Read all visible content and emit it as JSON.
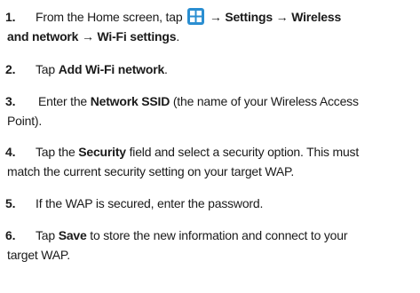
{
  "steps": [
    {
      "number": "1.",
      "pre": "From the Home screen, tap",
      "icon": "apps-grid-icon",
      "arrow1": "→",
      "settings": "Settings",
      "arrow2": "→",
      "wireless_line1": "Wireless",
      "wireless_line2": "and network",
      "arrow3": "→",
      "wifi_settings": "Wi-Fi settings",
      "end": "."
    },
    {
      "number": "2.",
      "pre": "Tap",
      "bold": "Add Wi-Fi network",
      "end": "."
    },
    {
      "number": "3.",
      "pre": "Enter the",
      "bold": "Network SSID",
      "post_line1": "(the name of your Wireless Access",
      "line2": "Point)."
    },
    {
      "number": "4.",
      "pre": "Tap the",
      "bold": "Security",
      "post_line1": "field and select a security option. This must",
      "line2": "match the current security setting on your target WAP."
    },
    {
      "number": "5.",
      "text": "If the WAP is secured, enter the password."
    },
    {
      "number": "6.",
      "pre": "Tap",
      "bold": "Save",
      "post_line1": "to store the new information and connect to your",
      "line2": "target WAP."
    }
  ],
  "colors": {
    "text": "#1a1a1a",
    "icon_bg": "#2a8ed1"
  }
}
